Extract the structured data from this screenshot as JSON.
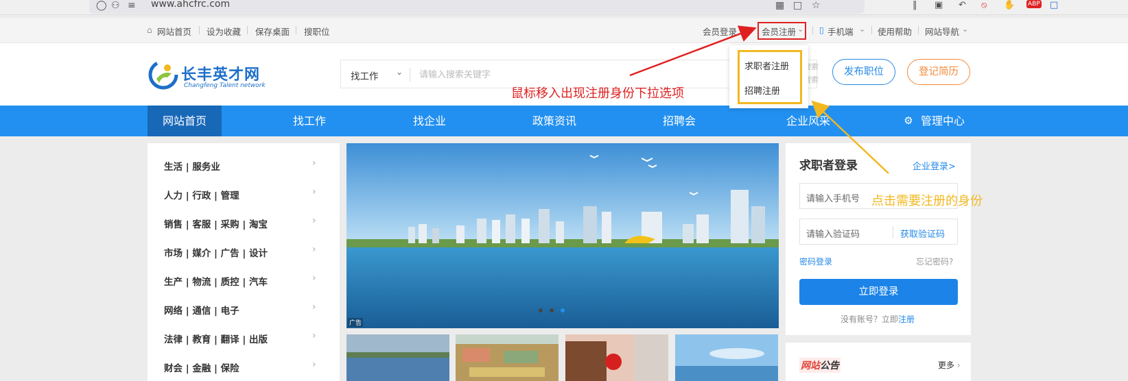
{
  "browser": {
    "url": "www.ahcfrc.com"
  },
  "topbar": {
    "home": "网站首页",
    "favorite": "设为收藏",
    "save_desktop": "保存桌面",
    "search_jobs": "搜职位",
    "member_login": "会员登录",
    "member_register": "会员注册",
    "mobile": "手机端",
    "help": "使用帮助",
    "site_nav": "网站导航"
  },
  "register_dropdown": {
    "items": [
      "求职者注册",
      "招聘注册"
    ]
  },
  "header": {
    "logo_cn": "长丰英才网",
    "logo_en": "Changfeng Talent network",
    "search_type": "找工作",
    "search_placeholder": "请输入搜索关键字",
    "search_extra1": "搜索",
    "search_extra2": "搜索",
    "post_job": "发布职位",
    "register_resume": "登记简历"
  },
  "nav": {
    "items": [
      "网站首页",
      "找工作",
      "找企业",
      "政策资讯",
      "招聘会",
      "企业风采",
      "管理中心"
    ]
  },
  "categories": [
    "生活 | 服务业",
    "人力 | 行政 | 管理",
    "销售 | 客服 | 采购 | 淘宝",
    "市场 | 媒介 | 广告 | 设计",
    "生产 | 物流 | 质控 | 汽车",
    "网络 | 通信 | 电子",
    "法律 | 教育 | 翻译 | 出版",
    "财会 | 金融 | 保险"
  ],
  "banner": {
    "ad_label": "广告"
  },
  "login": {
    "title": "求职者登录",
    "enterprise_login": "企业登录>",
    "phone_placeholder": "请输入手机号",
    "code_placeholder": "请输入验证码",
    "get_code": "获取验证码",
    "password_login": "密码登录",
    "forgot": "忘记密码?",
    "submit": "立即登录",
    "no_account": "没有账号？立即",
    "register": "注册"
  },
  "notice": {
    "title_a": "网站",
    "title_b": "公告",
    "more": "更多"
  },
  "annotations": {
    "red": "鼠标移入出现注册身份下拉选项",
    "yellow": "点击需要注册的身份"
  },
  "colors": {
    "brand_blue": "#2290f0",
    "nav_active": "#1868b8",
    "accent_orange": "#f28a3a",
    "annotation_red": "#e02020",
    "annotation_yellow": "#f2b820"
  }
}
